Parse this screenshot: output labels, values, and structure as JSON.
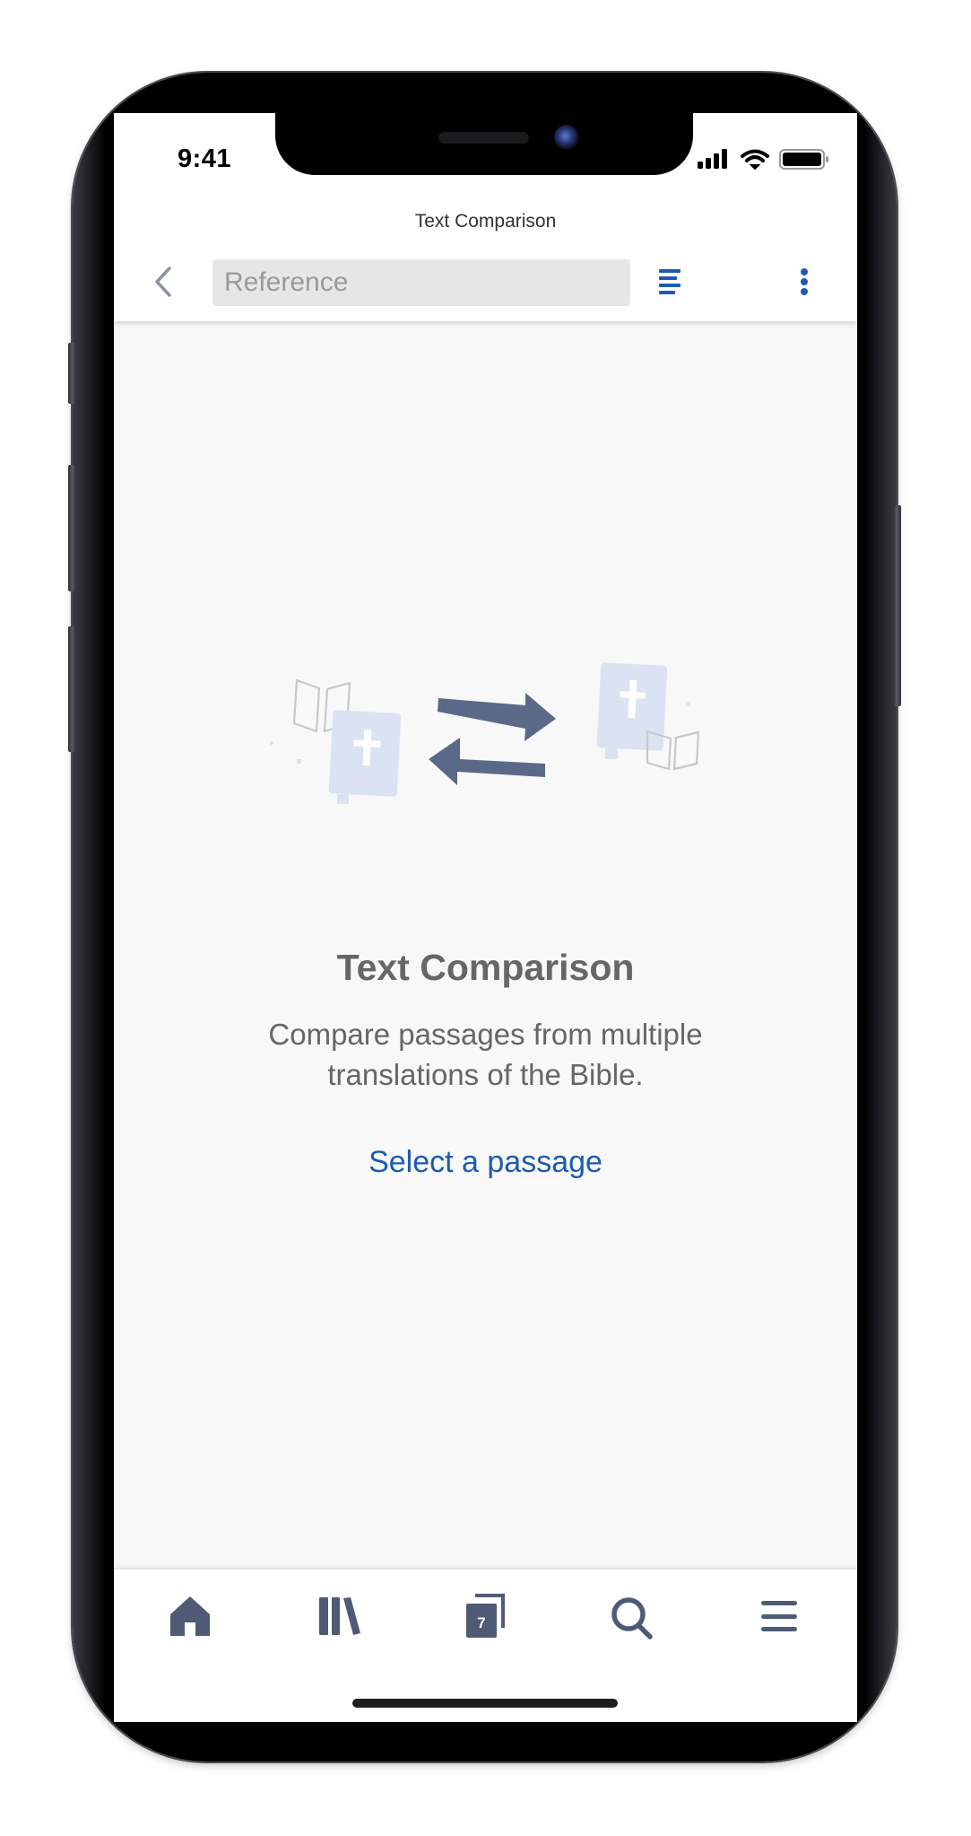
{
  "status_bar": {
    "time": "9:41",
    "icons": [
      "cellular-signal-icon",
      "wifi-icon",
      "battery-icon"
    ]
  },
  "header": {
    "title": "Text Comparison",
    "back_icon": "chevron-left-icon",
    "reference_placeholder": "Reference",
    "reference_value": "",
    "outline_icon": "text-lines-icon",
    "more_icon": "vertical-dots-icon"
  },
  "empty_state": {
    "illustration": "bibles-exchange-illustration",
    "title": "Text Comparison",
    "description_lines": [
      "Compare passages from multiple",
      "translations of the Bible."
    ],
    "action_label": "Select a passage"
  },
  "tab_bar": {
    "items": [
      {
        "name": "home",
        "icon": "home-icon"
      },
      {
        "name": "library",
        "icon": "library-icon"
      },
      {
        "name": "tabs",
        "icon": "tabs-icon",
        "badge": "7"
      },
      {
        "name": "search",
        "icon": "search-icon"
      },
      {
        "name": "menu",
        "icon": "hamburger-menu-icon"
      }
    ]
  },
  "colors": {
    "accent": "#1c5bb0",
    "tab_icon": "#4f5a75",
    "arrow": "#5a6987",
    "bible_fill": "#dbe2f3",
    "text_secondary": "#666666"
  }
}
